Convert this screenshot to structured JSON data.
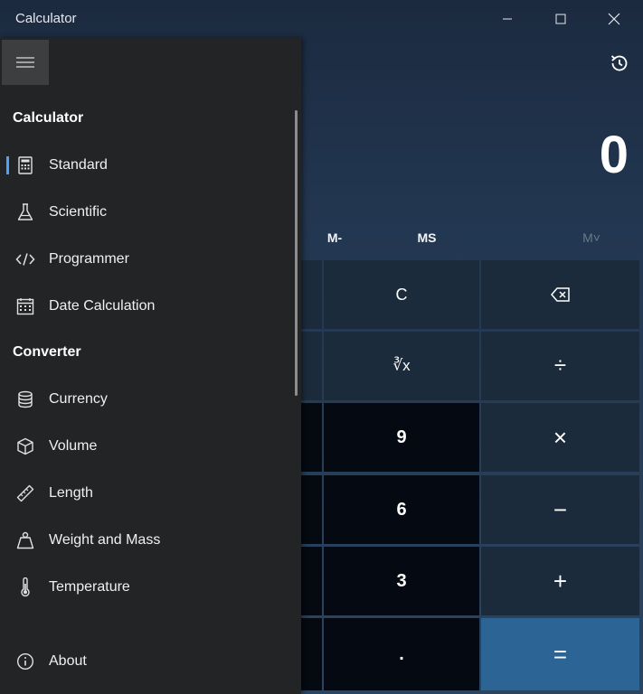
{
  "window": {
    "title": "Calculator"
  },
  "display": {
    "value": "0"
  },
  "memory": {
    "m_minus": "M-",
    "ms": "MS",
    "m_recall": "M˅"
  },
  "keypad": {
    "clear": "C",
    "cube_root": "∛x",
    "divide": "÷",
    "multiply": "×",
    "subtract": "−",
    "add": "+",
    "nine": "9",
    "six": "6",
    "three": "3",
    "decimal": ".",
    "equals": "="
  },
  "nav": {
    "calculator_header": "Calculator",
    "converter_header": "Converter",
    "items": [
      {
        "label": "Standard",
        "icon": "calculator-icon",
        "selected": true
      },
      {
        "label": "Scientific",
        "icon": "flask-icon",
        "selected": false
      },
      {
        "label": "Programmer",
        "icon": "code-icon",
        "selected": false
      },
      {
        "label": "Date Calculation",
        "icon": "calendar-icon",
        "selected": false
      }
    ],
    "converters": [
      {
        "label": "Currency",
        "icon": "coins-icon"
      },
      {
        "label": "Volume",
        "icon": "cube-icon"
      },
      {
        "label": "Length",
        "icon": "ruler-icon"
      },
      {
        "label": "Weight and Mass",
        "icon": "weight-icon"
      },
      {
        "label": "Temperature",
        "icon": "thermometer-icon"
      }
    ],
    "about": {
      "label": "About",
      "icon": "info-icon"
    }
  },
  "colors": {
    "accent": "#4aa3ff",
    "equals_key": "#2c6595",
    "nav_bg": "#232425"
  }
}
